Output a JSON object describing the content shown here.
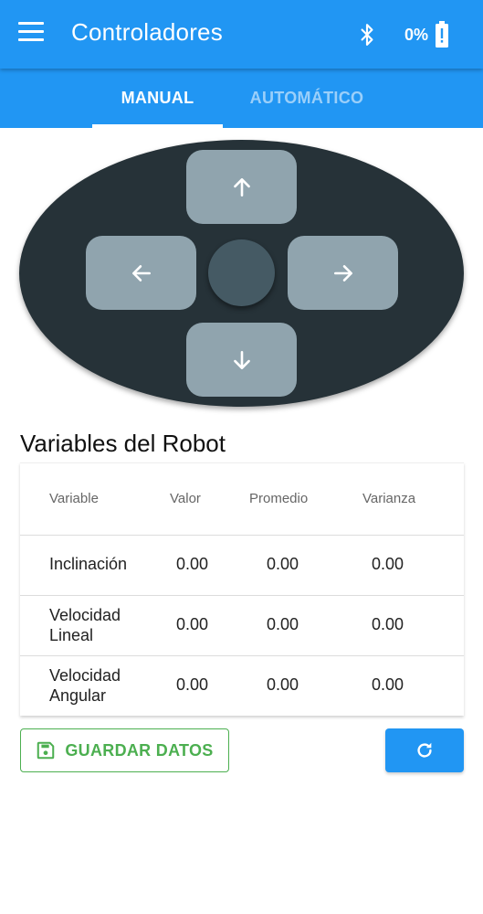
{
  "appbar": {
    "title": "Controladores",
    "menu_icon": "menu-icon",
    "bluetooth_icon": "bluetooth-icon",
    "battery_text": "0%",
    "battery_icon": "battery-alert-icon"
  },
  "tabs": [
    {
      "label": "MANUAL",
      "active": true
    },
    {
      "label": "AUTOMÁTICO",
      "active": false
    }
  ],
  "dpad": {
    "up_icon": "arrow-up-icon",
    "down_icon": "arrow-down-icon",
    "left_icon": "arrow-left-icon",
    "right_icon": "arrow-right-icon"
  },
  "variables": {
    "title": "Variables del Robot",
    "headers": [
      "Variable",
      "Valor",
      "Promedio",
      "Varianza"
    ],
    "rows": [
      {
        "name": "Inclinación",
        "valor": "0.00",
        "promedio": "0.00",
        "varianza": "0.00"
      },
      {
        "name": "Velocidad Lineal",
        "valor": "0.00",
        "promedio": "0.00",
        "varianza": "0.00"
      },
      {
        "name": "Velocidad Angular",
        "valor": "0.00",
        "promedio": "0.00",
        "varianza": "0.00"
      }
    ]
  },
  "actions": {
    "save_label": "GUARDAR DATOS",
    "save_icon": "floppy-disk-icon",
    "refresh_icon": "refresh-icon"
  },
  "colors": {
    "primary": "#2196f3",
    "pad_background": "#263238",
    "pad_button": "#90a4ae",
    "save_green": "#4caf50"
  }
}
